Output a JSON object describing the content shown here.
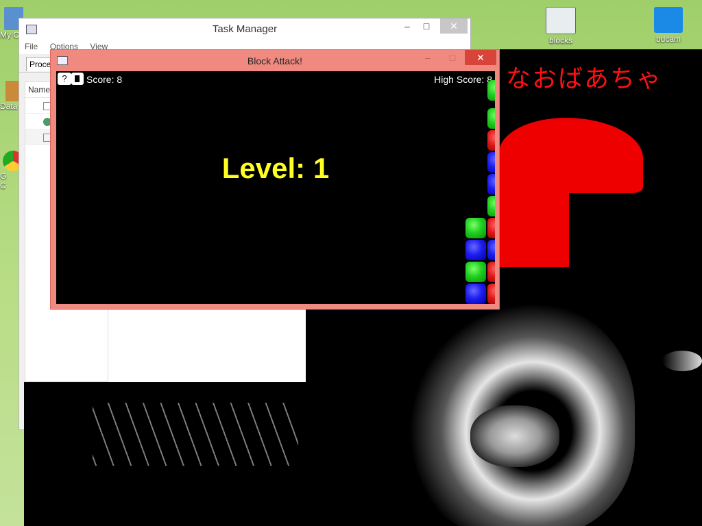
{
  "desktop": {
    "icons": [
      {
        "label": "blocks"
      },
      {
        "label": "bdcam"
      }
    ],
    "left_labels": {
      "my_computer": "My C",
      "data": "Data",
      "chrome_1": "G",
      "chrome_2": "C"
    }
  },
  "task_manager": {
    "title": "Task Manager",
    "menu": [
      "File",
      "Options",
      "View"
    ],
    "tab_label": "Proce",
    "column_header": "Name"
  },
  "block_attack": {
    "title": "Block Attack!",
    "help_label": "?",
    "score_text": "Score: 8",
    "high_score_text": "High Score: 8",
    "level_text": "Level: 1",
    "colors": {
      "green": "#1fcf1f",
      "blue": "#1d1df0",
      "red": "#e01818",
      "level": "#ffff22",
      "window_frame": "#f08a80"
    }
  },
  "background_art": {
    "japanese_text": "なおばあちゃ"
  }
}
